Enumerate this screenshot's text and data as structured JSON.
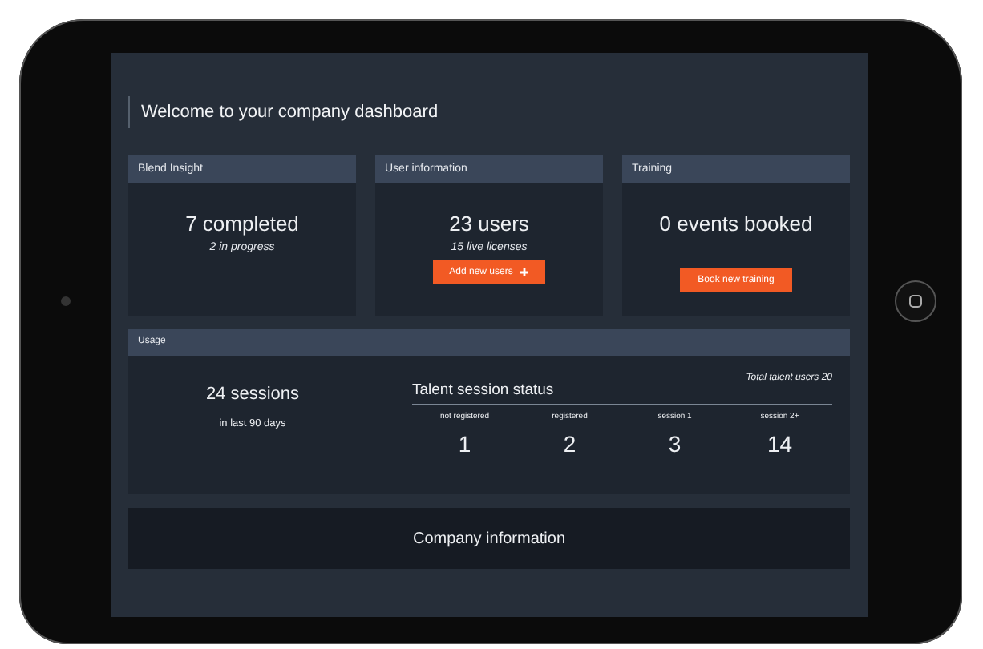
{
  "title": "Welcome to your company dashboard",
  "cards": [
    {
      "header": "Blend Insight",
      "value": "7 completed",
      "subtext": "2 in progress"
    },
    {
      "header": "User information",
      "value": "23 users",
      "subtext": "15 live licenses",
      "button": {
        "label": "Add new users",
        "kind": "add"
      }
    },
    {
      "header": "Training",
      "value": "0 events booked",
      "button": {
        "label": "Book new training",
        "kind": "plain"
      }
    }
  ],
  "usage": {
    "header": "Usage",
    "sessions": "24 sessions",
    "period": "in last 90 days",
    "status_title": "Talent session status",
    "total": "Total talent users 20",
    "columns": [
      {
        "label": "not registered",
        "value": "1"
      },
      {
        "label": "registered",
        "value": "2"
      },
      {
        "label": "session 1",
        "value": "3"
      },
      {
        "label": "session 2+",
        "value": "14"
      }
    ]
  },
  "company": {
    "title": "Company information"
  }
}
